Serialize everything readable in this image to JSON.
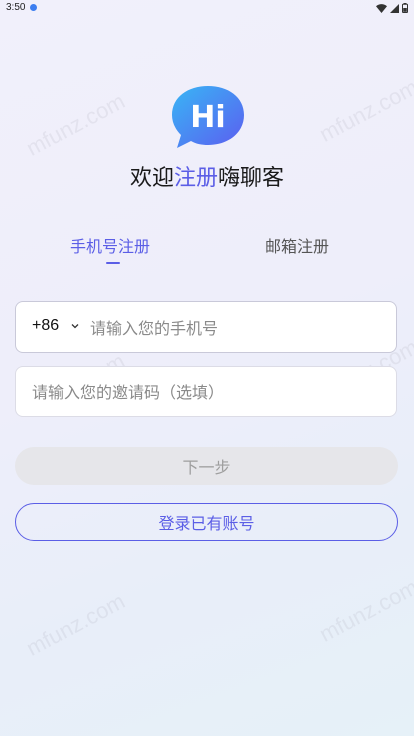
{
  "status_bar": {
    "time": "3:50",
    "icons": [
      "notification-dot-icon",
      "wifi-icon",
      "cellular-signal-icon",
      "battery-icon"
    ]
  },
  "watermark": "mfunz.com",
  "logo": {
    "text": "Hi",
    "colors": {
      "gradient_start": "#38b6f5",
      "gradient_end": "#5c5df0"
    }
  },
  "welcome": {
    "prefix": "欢迎",
    "accent": "注册",
    "suffix": "嗨聊客"
  },
  "tabs": [
    {
      "label": "手机号注册",
      "active": true
    },
    {
      "label": "邮箱注册",
      "active": false
    }
  ],
  "phone_input": {
    "country_code": "+86",
    "placeholder": "请输入您的手机号",
    "value": ""
  },
  "invite_input": {
    "placeholder": "请输入您的邀请码（选填）",
    "value": ""
  },
  "buttons": {
    "next": "下一步",
    "login": "登录已有账号"
  },
  "colors": {
    "accent": "#5b5ee6",
    "disabled_bg": "#e6e6ea",
    "disabled_text": "#9e9e9e"
  }
}
